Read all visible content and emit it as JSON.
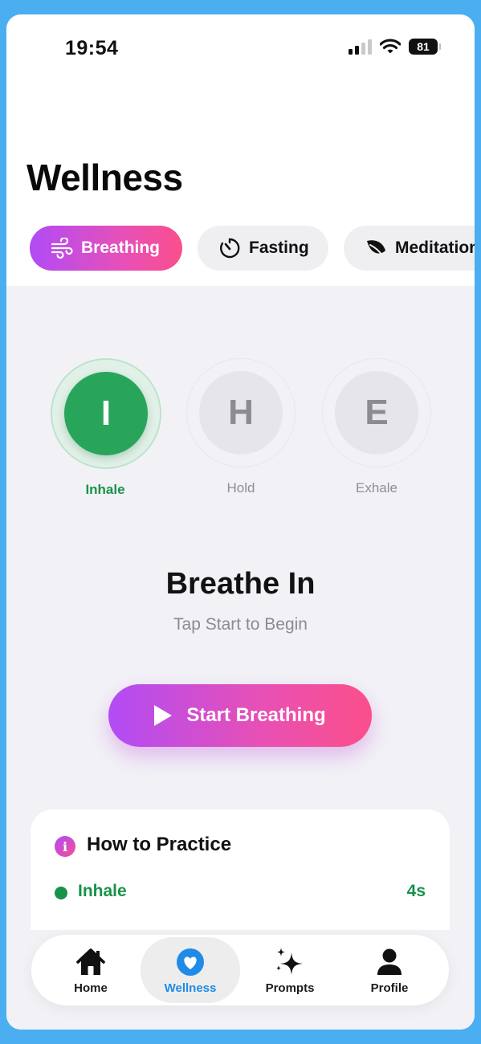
{
  "status_bar": {
    "time": "19:54",
    "battery": "81"
  },
  "header": {
    "title": "Wellness"
  },
  "tabs": [
    {
      "label": "Breathing",
      "icon": "wind-icon",
      "active": true
    },
    {
      "label": "Fasting",
      "icon": "timer-icon",
      "active": false
    },
    {
      "label": "Meditation",
      "icon": "leaf-icon",
      "active": false
    }
  ],
  "phases": [
    {
      "letter": "I",
      "label": "Inhale",
      "active": true
    },
    {
      "letter": "H",
      "label": "Hold",
      "active": false
    },
    {
      "letter": "E",
      "label": "Exhale",
      "active": false
    }
  ],
  "breathing": {
    "title": "Breathe In",
    "subtitle": "Tap Start to Begin",
    "start_label": "Start Breathing"
  },
  "practice_card": {
    "title": "How to Practice",
    "steps": [
      {
        "label": "Inhale",
        "duration": "4s"
      }
    ]
  },
  "bottom_nav": [
    {
      "label": "Home",
      "icon": "home-icon",
      "active": false
    },
    {
      "label": "Wellness",
      "icon": "heart-icon",
      "active": true
    },
    {
      "label": "Prompts",
      "icon": "sparkles-icon",
      "active": false
    },
    {
      "label": "Profile",
      "icon": "person-icon",
      "active": false
    }
  ],
  "colors": {
    "accent_gradient_start": "#B04BF6",
    "accent_gradient_end": "#FB4F8D",
    "inhale_green": "#29A55B",
    "nav_active_blue": "#1F8BE6",
    "background": "#F2F2F6"
  }
}
